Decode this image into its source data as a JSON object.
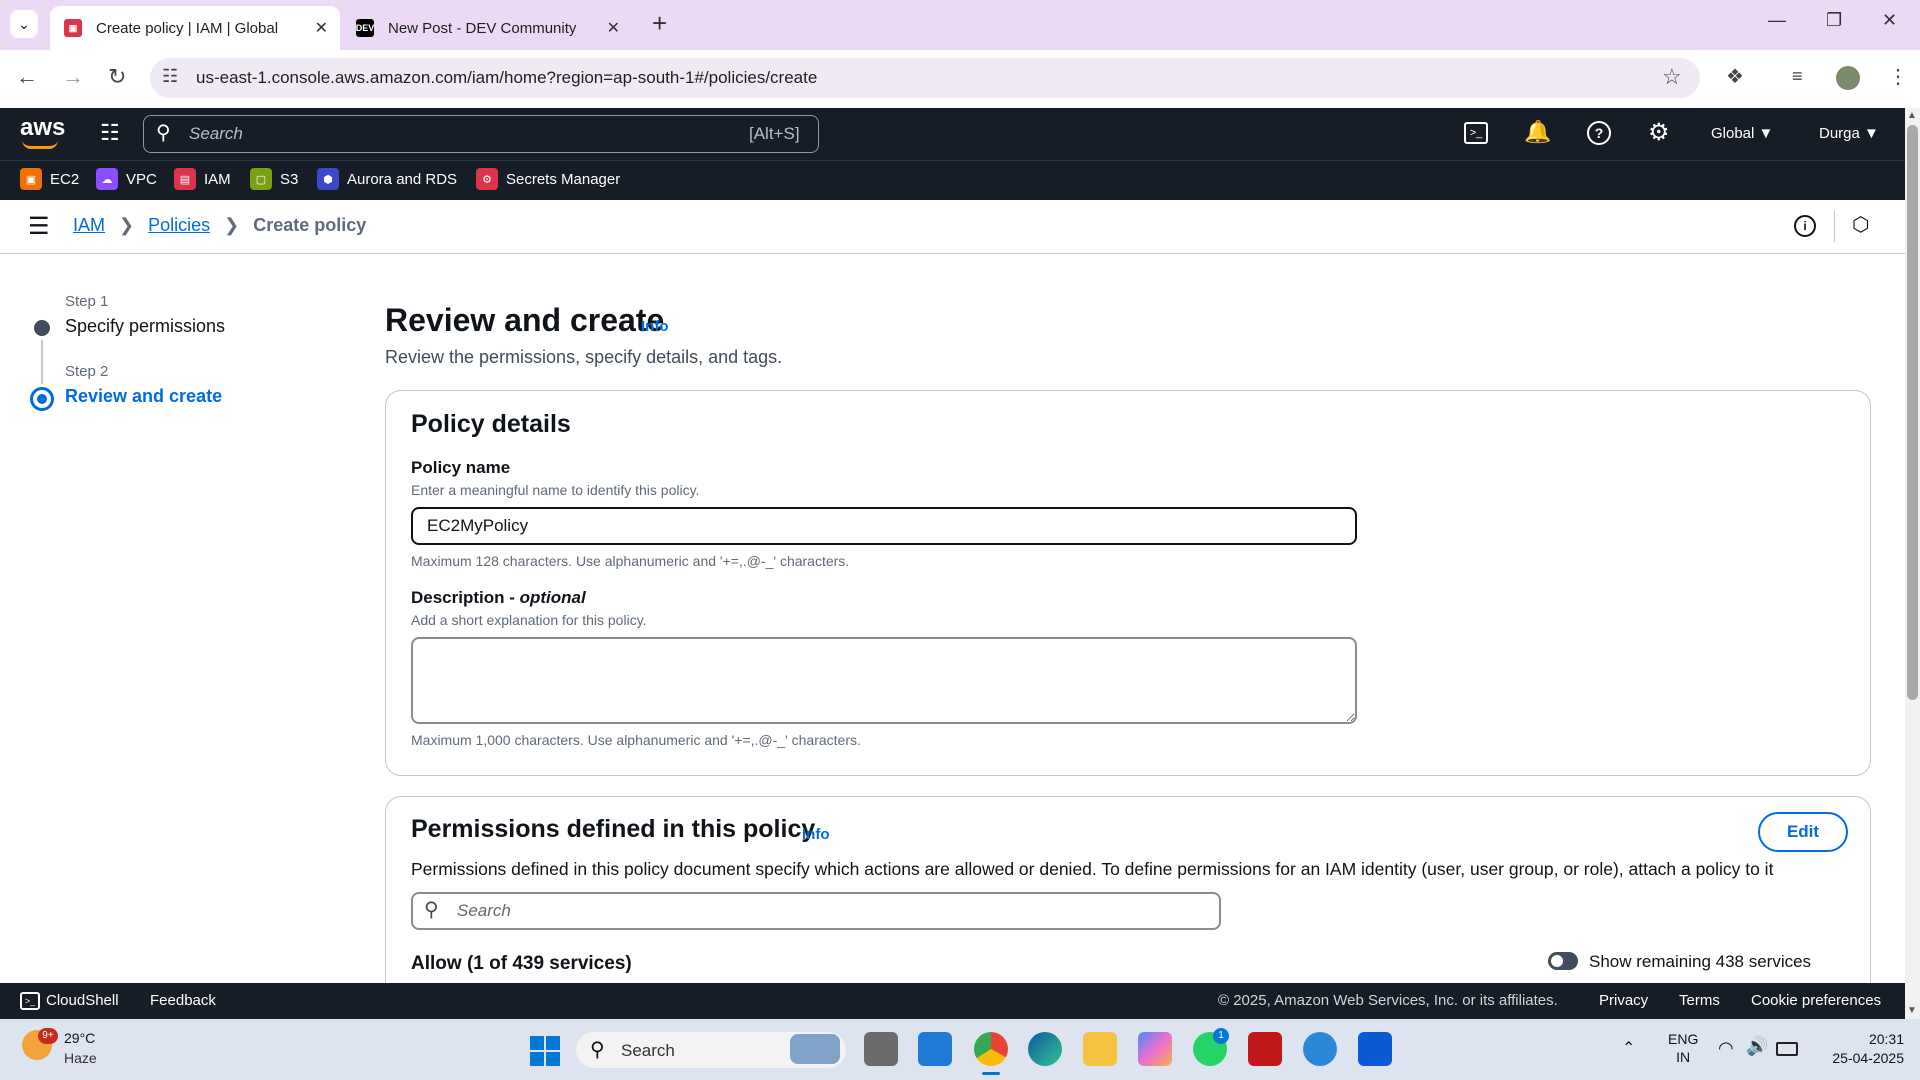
{
  "browser": {
    "tabs": [
      {
        "title": "Create policy | IAM | Global",
        "favicon_color": "#dd344c"
      },
      {
        "title": "New Post - DEV Community",
        "favicon_color": "#000000"
      }
    ],
    "url": "us-east-1.console.aws.amazon.com/iam/home?region=ap-south-1#/policies/create",
    "new_tab": "+"
  },
  "aws_nav": {
    "logo": "aws",
    "search_placeholder": "Search",
    "search_shortcut": "[Alt+S]",
    "region": "Global",
    "user": "Durga",
    "favorites": [
      {
        "label": "EC2",
        "color": "#ed7100"
      },
      {
        "label": "VPC",
        "color": "#8c4fff"
      },
      {
        "label": "IAM",
        "color": "#dd344c"
      },
      {
        "label": "S3",
        "color": "#7aa116"
      },
      {
        "label": "Aurora and RDS",
        "color": "#3b48cc"
      },
      {
        "label": "Secrets Manager",
        "color": "#dd344c"
      }
    ]
  },
  "breadcrumb": {
    "items": [
      "IAM",
      "Policies"
    ],
    "current": "Create policy"
  },
  "steps": [
    {
      "step": "Step 1",
      "title": "Specify permissions"
    },
    {
      "step": "Step 2",
      "title": "Review and create"
    }
  ],
  "page": {
    "title": "Review and create",
    "info": "Info",
    "subtitle": "Review the permissions, specify details, and tags."
  },
  "policy_details": {
    "heading": "Policy details",
    "name_label": "Policy name",
    "name_hint": "Enter a meaningful name to identify this policy.",
    "name_value": "EC2MyPolicy",
    "name_constraint": "Maximum 128 characters. Use alphanumeric and '+=,.@-_' characters.",
    "desc_label": "Description - ",
    "desc_optional": "optional",
    "desc_hint": "Add a short explanation for this policy.",
    "desc_value": "",
    "desc_constraint": "Maximum 1,000 characters. Use alphanumeric and '+=,.@-_' characters."
  },
  "permissions": {
    "heading": "Permissions defined in this policy",
    "info": "Info",
    "edit": "Edit",
    "description": "Permissions defined in this policy document specify which actions are allowed or denied. To define permissions for an IAM identity (user, user group, or role), attach a policy to it",
    "search_placeholder": "Search",
    "allow_label": "Allow (1 of 439 services)",
    "toggle_label": "Show remaining 438 services"
  },
  "footer": {
    "cloudshell": "CloudShell",
    "feedback": "Feedback",
    "copyright": "© 2025, Amazon Web Services, Inc. or its affiliates.",
    "links": [
      "Privacy",
      "Terms",
      "Cookie preferences"
    ]
  },
  "taskbar": {
    "temp": "29°C",
    "weather": "Haze",
    "weather_badge": "9+",
    "search": "Search",
    "lang1": "ENG",
    "lang2": "IN",
    "time": "20:31",
    "date": "25-04-2025",
    "whatsapp_badge": "1"
  }
}
